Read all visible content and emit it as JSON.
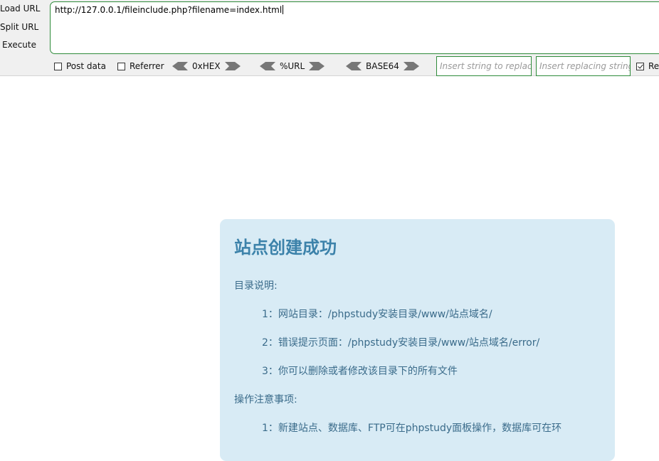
{
  "hackbar": {
    "actions": [
      "Load URL",
      "Split URL",
      "Execute"
    ],
    "url": "http://127.0.0.1/fileinclude.php?filename=index.html",
    "options": {
      "post_data": {
        "label": "Post data",
        "checked": false
      },
      "referrer": {
        "label": "Referrer",
        "checked": false
      }
    },
    "encoders": [
      "0xHEX",
      "%URL",
      "BASE64"
    ],
    "replace_placeholder": "Insert string to replace",
    "replacing_placeholder": "Insert replacing string",
    "replace_all": {
      "label": "Re",
      "checked": true
    }
  },
  "page": {
    "title": "站点创建成功",
    "dir_heading": "目录说明:",
    "dir_items": [
      "1：网站目录：/phpstudy安装目录/www/站点域名/",
      "2：错误提示页面：/phpstudy安装目录/www/站点域名/error/",
      "3：你可以删除或者修改该目录下的所有文件"
    ],
    "notes_heading": "操作注意事项:",
    "notes_items": [
      "1：新建站点、数据库、FTP可在phpstudy面板操作，数据库可在环"
    ]
  }
}
